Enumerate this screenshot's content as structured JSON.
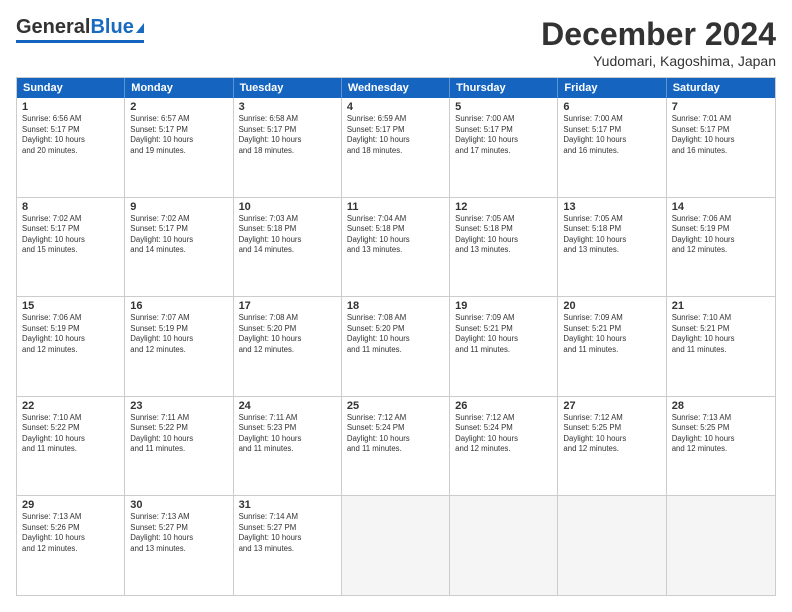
{
  "header": {
    "logo_general": "General",
    "logo_blue": "Blue",
    "month_title": "December 2024",
    "location": "Yudomari, Kagoshima, Japan"
  },
  "calendar": {
    "days_of_week": [
      "Sunday",
      "Monday",
      "Tuesday",
      "Wednesday",
      "Thursday",
      "Friday",
      "Saturday"
    ],
    "weeks": [
      [
        {
          "day": "",
          "text": ""
        },
        {
          "day": "2",
          "text": "Sunrise: 6:57 AM\nSunset: 5:17 PM\nDaylight: 10 hours\nand 19 minutes."
        },
        {
          "day": "3",
          "text": "Sunrise: 6:58 AM\nSunset: 5:17 PM\nDaylight: 10 hours\nand 18 minutes."
        },
        {
          "day": "4",
          "text": "Sunrise: 6:59 AM\nSunset: 5:17 PM\nDaylight: 10 hours\nand 18 minutes."
        },
        {
          "day": "5",
          "text": "Sunrise: 7:00 AM\nSunset: 5:17 PM\nDaylight: 10 hours\nand 17 minutes."
        },
        {
          "day": "6",
          "text": "Sunrise: 7:00 AM\nSunset: 5:17 PM\nDaylight: 10 hours\nand 16 minutes."
        },
        {
          "day": "7",
          "text": "Sunrise: 7:01 AM\nSunset: 5:17 PM\nDaylight: 10 hours\nand 16 minutes."
        }
      ],
      [
        {
          "day": "1",
          "text": "Sunrise: 6:56 AM\nSunset: 5:17 PM\nDaylight: 10 hours\nand 20 minutes."
        },
        {
          "day": "9",
          "text": "Sunrise: 7:02 AM\nSunset: 5:17 PM\nDaylight: 10 hours\nand 14 minutes."
        },
        {
          "day": "10",
          "text": "Sunrise: 7:03 AM\nSunset: 5:18 PM\nDaylight: 10 hours\nand 14 minutes."
        },
        {
          "day": "11",
          "text": "Sunrise: 7:04 AM\nSunset: 5:18 PM\nDaylight: 10 hours\nand 13 minutes."
        },
        {
          "day": "12",
          "text": "Sunrise: 7:05 AM\nSunset: 5:18 PM\nDaylight: 10 hours\nand 13 minutes."
        },
        {
          "day": "13",
          "text": "Sunrise: 7:05 AM\nSunset: 5:18 PM\nDaylight: 10 hours\nand 13 minutes."
        },
        {
          "day": "14",
          "text": "Sunrise: 7:06 AM\nSunset: 5:19 PM\nDaylight: 10 hours\nand 12 minutes."
        }
      ],
      [
        {
          "day": "8",
          "text": "Sunrise: 7:02 AM\nSunset: 5:17 PM\nDaylight: 10 hours\nand 15 minutes."
        },
        {
          "day": "16",
          "text": "Sunrise: 7:07 AM\nSunset: 5:19 PM\nDaylight: 10 hours\nand 12 minutes."
        },
        {
          "day": "17",
          "text": "Sunrise: 7:08 AM\nSunset: 5:20 PM\nDaylight: 10 hours\nand 12 minutes."
        },
        {
          "day": "18",
          "text": "Sunrise: 7:08 AM\nSunset: 5:20 PM\nDaylight: 10 hours\nand 11 minutes."
        },
        {
          "day": "19",
          "text": "Sunrise: 7:09 AM\nSunset: 5:21 PM\nDaylight: 10 hours\nand 11 minutes."
        },
        {
          "day": "20",
          "text": "Sunrise: 7:09 AM\nSunset: 5:21 PM\nDaylight: 10 hours\nand 11 minutes."
        },
        {
          "day": "21",
          "text": "Sunrise: 7:10 AM\nSunset: 5:21 PM\nDaylight: 10 hours\nand 11 minutes."
        }
      ],
      [
        {
          "day": "15",
          "text": "Sunrise: 7:06 AM\nSunset: 5:19 PM\nDaylight: 10 hours\nand 12 minutes."
        },
        {
          "day": "23",
          "text": "Sunrise: 7:11 AM\nSunset: 5:22 PM\nDaylight: 10 hours\nand 11 minutes."
        },
        {
          "day": "24",
          "text": "Sunrise: 7:11 AM\nSunset: 5:23 PM\nDaylight: 10 hours\nand 11 minutes."
        },
        {
          "day": "25",
          "text": "Sunrise: 7:12 AM\nSunset: 5:24 PM\nDaylight: 10 hours\nand 11 minutes."
        },
        {
          "day": "26",
          "text": "Sunrise: 7:12 AM\nSunset: 5:24 PM\nDaylight: 10 hours\nand 12 minutes."
        },
        {
          "day": "27",
          "text": "Sunrise: 7:12 AM\nSunset: 5:25 PM\nDaylight: 10 hours\nand 12 minutes."
        },
        {
          "day": "28",
          "text": "Sunrise: 7:13 AM\nSunset: 5:25 PM\nDaylight: 10 hours\nand 12 minutes."
        }
      ],
      [
        {
          "day": "22",
          "text": "Sunrise: 7:10 AM\nSunset: 5:22 PM\nDaylight: 10 hours\nand 11 minutes."
        },
        {
          "day": "30",
          "text": "Sunrise: 7:13 AM\nSunset: 5:27 PM\nDaylight: 10 hours\nand 13 minutes."
        },
        {
          "day": "31",
          "text": "Sunrise: 7:14 AM\nSunset: 5:27 PM\nDaylight: 10 hours\nand 13 minutes."
        },
        {
          "day": "",
          "text": ""
        },
        {
          "day": "",
          "text": ""
        },
        {
          "day": "",
          "text": ""
        },
        {
          "day": "",
          "text": ""
        }
      ],
      [
        {
          "day": "29",
          "text": "Sunrise: 7:13 AM\nSunset: 5:26 PM\nDaylight: 10 hours\nand 12 minutes."
        },
        {
          "day": "",
          "text": ""
        },
        {
          "day": "",
          "text": ""
        },
        {
          "day": "",
          "text": ""
        },
        {
          "day": "",
          "text": ""
        },
        {
          "day": "",
          "text": ""
        },
        {
          "day": "",
          "text": ""
        }
      ]
    ]
  }
}
